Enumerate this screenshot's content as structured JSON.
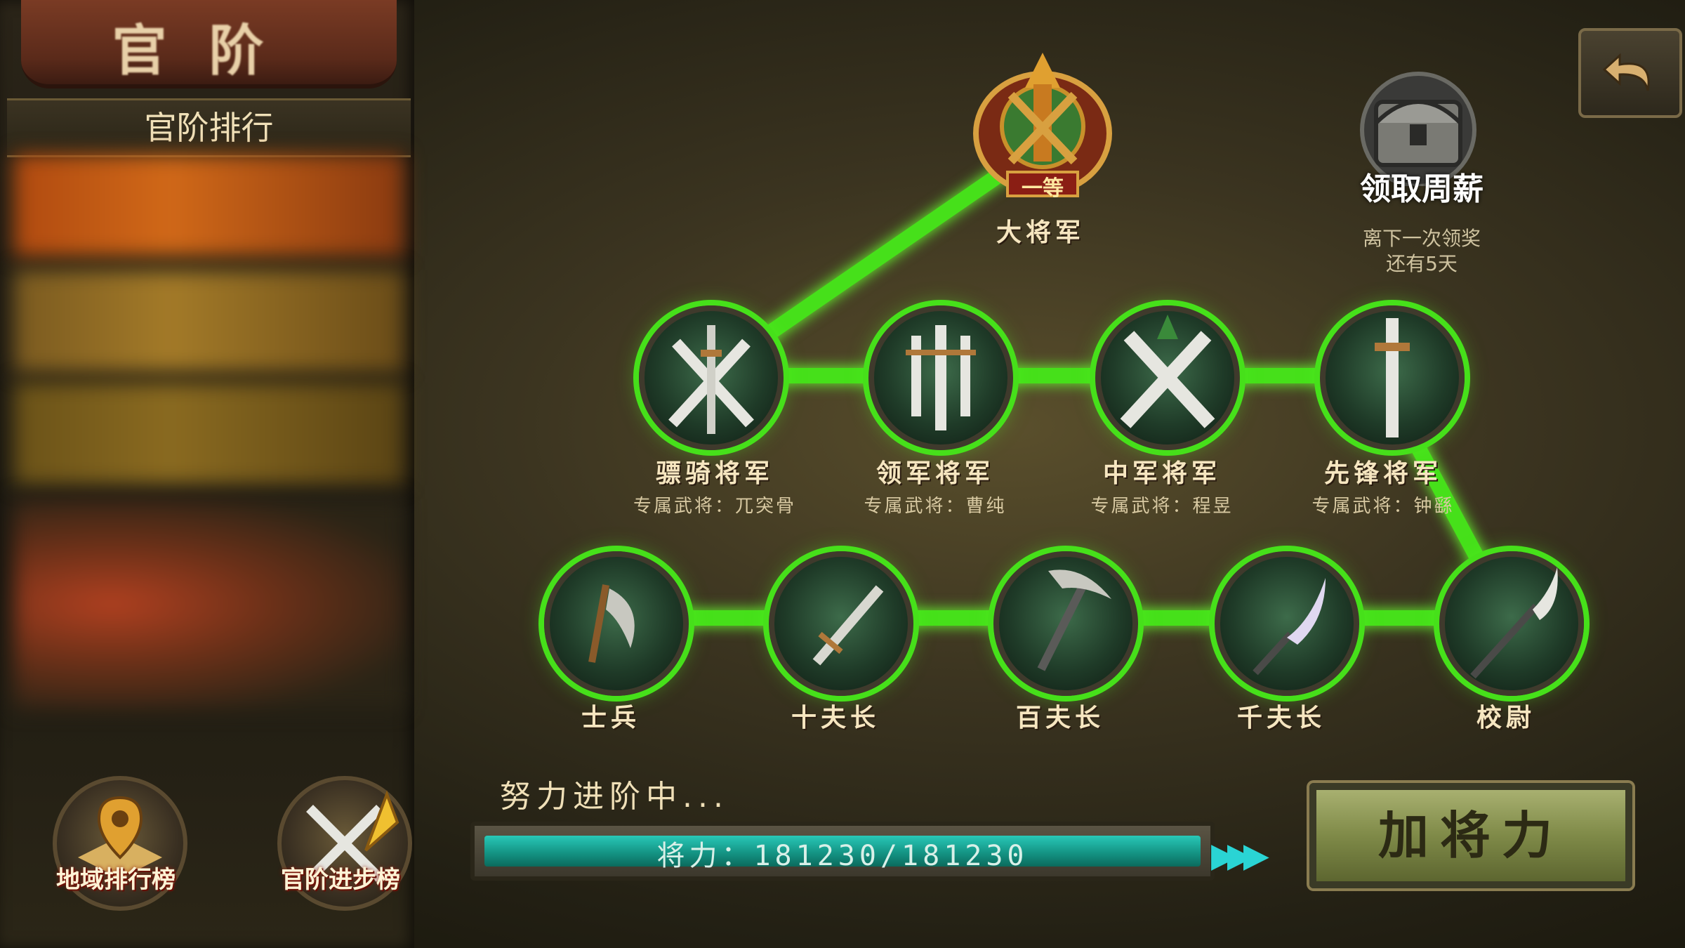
{
  "left_panel": {
    "title": "官阶",
    "rank_header": "官阶排行"
  },
  "top_node": {
    "label": "大将军",
    "badge": "一等"
  },
  "reward": {
    "label": "领取周薪",
    "sub_line1": "离下一次领奖",
    "sub_line2": "还有5天"
  },
  "general_nodes": [
    {
      "label": "骠骑将军",
      "sub": "专属武将：兀突骨"
    },
    {
      "label": "领军将军",
      "sub": "专属武将：曹纯"
    },
    {
      "label": "中军将军",
      "sub": "专属武将：程昱"
    },
    {
      "label": "先锋将军",
      "sub": "专属武将：钟繇"
    }
  ],
  "soldier_nodes": [
    {
      "label": "士兵"
    },
    {
      "label": "十夫长"
    },
    {
      "label": "百夫长"
    },
    {
      "label": "千夫长"
    },
    {
      "label": "校尉"
    }
  ],
  "progress": {
    "caption": "努力进阶中...",
    "text": "将力：181230/181230",
    "current": 181230,
    "max": 181230,
    "fill_fraction": 1.0
  },
  "buttons": {
    "add_power": "加将力",
    "region_rank": "地域排行榜",
    "rank_progress": "官阶进步榜"
  },
  "colors": {
    "path_glow": "#46e01a",
    "progress_fill": "#139080",
    "button_face": "#7f8a48"
  },
  "icons": {
    "back": "back-arrow-icon",
    "chest": "treasure-chest-icon",
    "region": "map-pin-icon",
    "progress_rank": "crossed-swords-arrow-icon"
  }
}
